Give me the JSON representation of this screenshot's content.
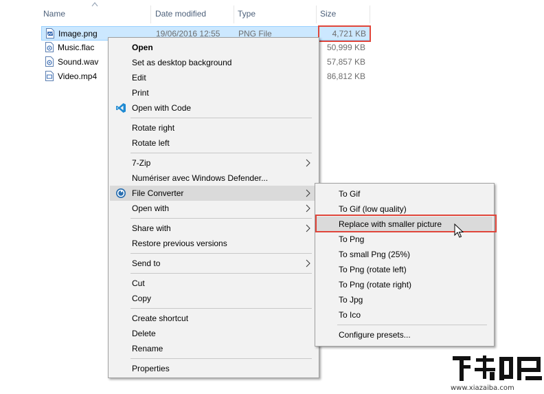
{
  "columns": {
    "name": "Name",
    "date_modified": "Date modified",
    "type": "Type",
    "size": "Size"
  },
  "files": [
    {
      "name": "Image.png",
      "date": "19/06/2016 12:55",
      "type": "PNG File",
      "size": "4,721 KB",
      "icon": "image-file-icon",
      "selected": true
    },
    {
      "name": "Music.flac",
      "date": "",
      "type": "",
      "size": "50,999 KB",
      "icon": "audio-file-icon",
      "selected": false
    },
    {
      "name": "Sound.wav",
      "date": "",
      "type": "",
      "size": "57,857 KB",
      "icon": "audio-file-icon",
      "selected": false
    },
    {
      "name": "Video.mp4",
      "date": "",
      "type": "",
      "size": "86,812 KB",
      "icon": "video-file-icon",
      "selected": false
    }
  ],
  "context_menu": {
    "open": "Open",
    "set_desktop_bg": "Set as desktop background",
    "edit": "Edit",
    "print": "Print",
    "open_with_code": "Open with Code",
    "rotate_right": "Rotate right",
    "rotate_left": "Rotate left",
    "seven_zip": "7-Zip",
    "defender": "Numériser avec Windows Defender...",
    "file_converter": "File Converter",
    "open_with": "Open with",
    "share_with": "Share with",
    "restore_versions": "Restore previous versions",
    "send_to": "Send to",
    "cut": "Cut",
    "copy": "Copy",
    "create_shortcut": "Create shortcut",
    "delete": "Delete",
    "rename": "Rename",
    "properties": "Properties"
  },
  "submenu": {
    "to_gif": "To Gif",
    "to_gif_low": "To Gif (low quality)",
    "replace_smaller": "Replace with smaller picture",
    "to_png": "To Png",
    "to_small_png": "To small Png (25%)",
    "to_png_rotate_left": "To Png (rotate left)",
    "to_png_rotate_right": "To Png (rotate right)",
    "to_jpg": "To Jpg",
    "to_ico": "To Ico",
    "configure_presets": "Configure presets..."
  },
  "watermark": {
    "url": "www.xiazaiba.com"
  },
  "colors": {
    "highlight_box": "#e0453a",
    "selection_bg": "#cce8ff",
    "menu_bg": "#f2f2f2",
    "vscode_blue": "#1f8ad2",
    "converter_blue": "#2a6fb0"
  }
}
